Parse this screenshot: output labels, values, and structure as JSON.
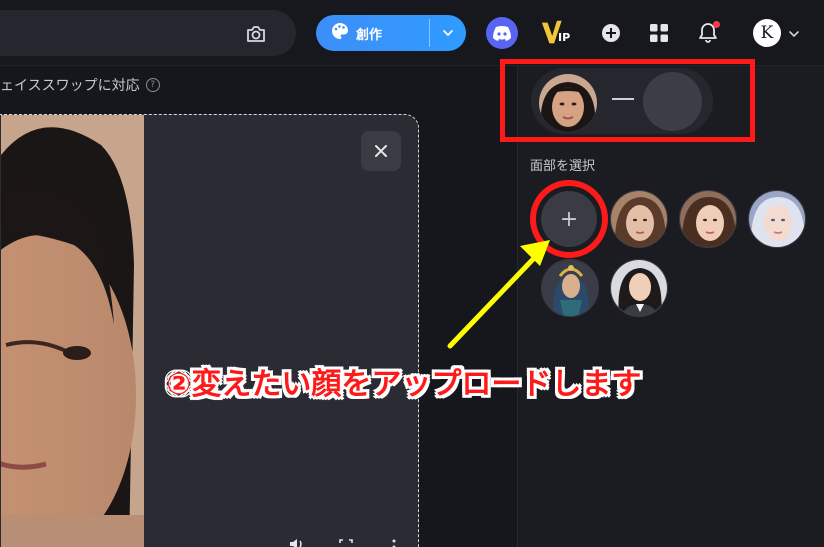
{
  "header": {
    "create_label": "創作",
    "vip_label": "IP",
    "user_initial": "K",
    "icons": [
      "camera-icon",
      "palette-icon",
      "chevron-down-icon",
      "discord-icon",
      "vip-icon",
      "plus-circle-icon",
      "apps-grid-icon",
      "bell-icon",
      "chevron-down-icon"
    ],
    "accent_color": "#3d8ef8",
    "notification_color": "#ff3b4e"
  },
  "main": {
    "subtitle": "ェイススワップに対応",
    "help_glyph": "?"
  },
  "panel": {
    "face_label": "面部を選択",
    "upload_glyph": "+",
    "preset_faces": [
      "face-preset-1",
      "face-preset-2",
      "face-preset-3",
      "face-preset-4",
      "face-preset-5"
    ]
  },
  "annotation": {
    "text": "②変えたい顔をアップロードします",
    "color": "#ff1a1a",
    "arrow_color": "#ffff00"
  }
}
